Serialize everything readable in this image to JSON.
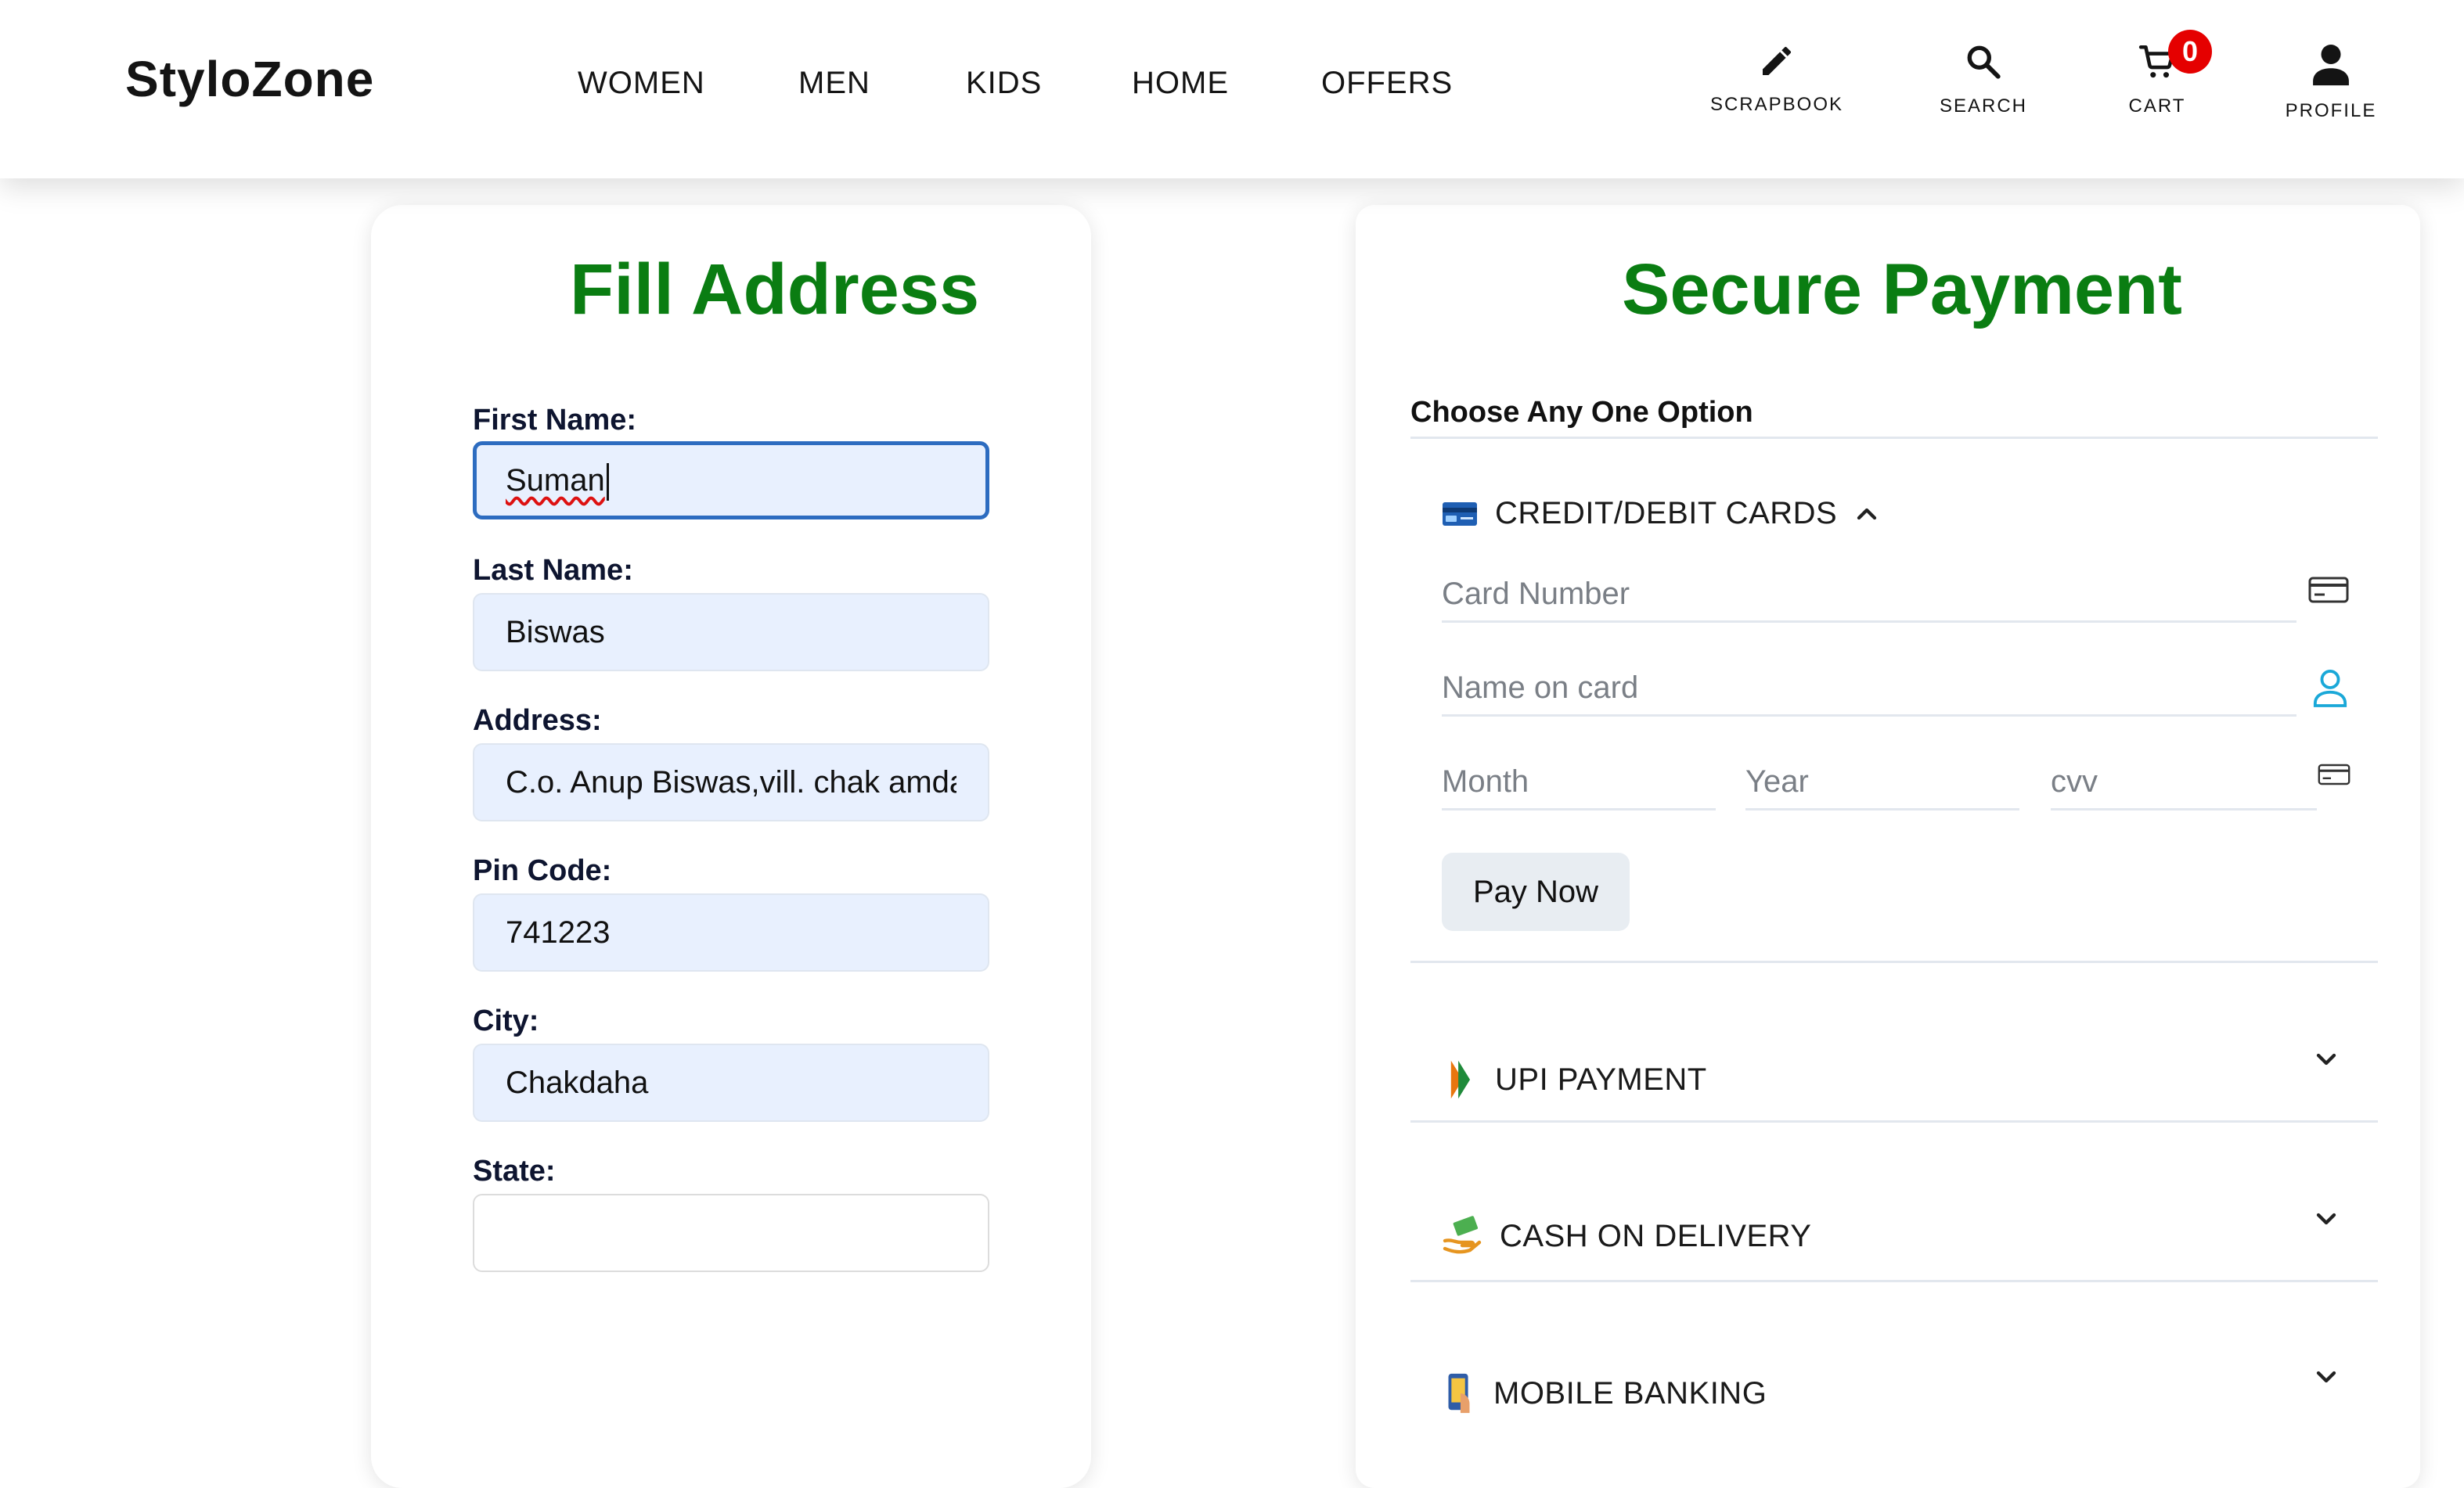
{
  "header": {
    "logo": "StyloZone",
    "nav": [
      "WOMEN",
      "MEN",
      "KIDS",
      "HOME",
      "OFFERS"
    ],
    "icons": {
      "scrapbook": "SCRAPBOOK",
      "search": "SEARCH",
      "cart": "CART",
      "cart_count": "0",
      "profile": "PROFILE"
    }
  },
  "address": {
    "title": "Fill Address",
    "fields": [
      {
        "label": "First Name:",
        "value": "Suman"
      },
      {
        "label": "Last Name:",
        "value": "Biswas"
      },
      {
        "label": "Address:",
        "value": "C.o. Anup Biswas,vill. chak amdanga"
      },
      {
        "label": "Pin Code:",
        "value": "741223"
      },
      {
        "label": "City:",
        "value": "Chakdaha"
      },
      {
        "label": "State:",
        "value": ""
      }
    ]
  },
  "payment": {
    "title": "Secure Payment",
    "choose_label": "Choose Any One Option",
    "options": {
      "card": "CREDIT/DEBIT CARDS",
      "upi": "UPI PAYMENT",
      "cod": "CASH ON DELIVERY",
      "mobile": "MOBILE BANKING"
    },
    "placeholders": {
      "card_number": "Card Number",
      "name_on_card": "Name on card",
      "month": "Month",
      "year": "Year",
      "cvv": "cvv"
    },
    "pay_button": "Pay Now"
  },
  "colors": {
    "title_green": "#0a7d12",
    "input_fill": "#e8f0fe",
    "focus_border": "#2d6cc0",
    "badge_red": "#e50000",
    "user_icon_cyan": "#1aa8d8"
  }
}
